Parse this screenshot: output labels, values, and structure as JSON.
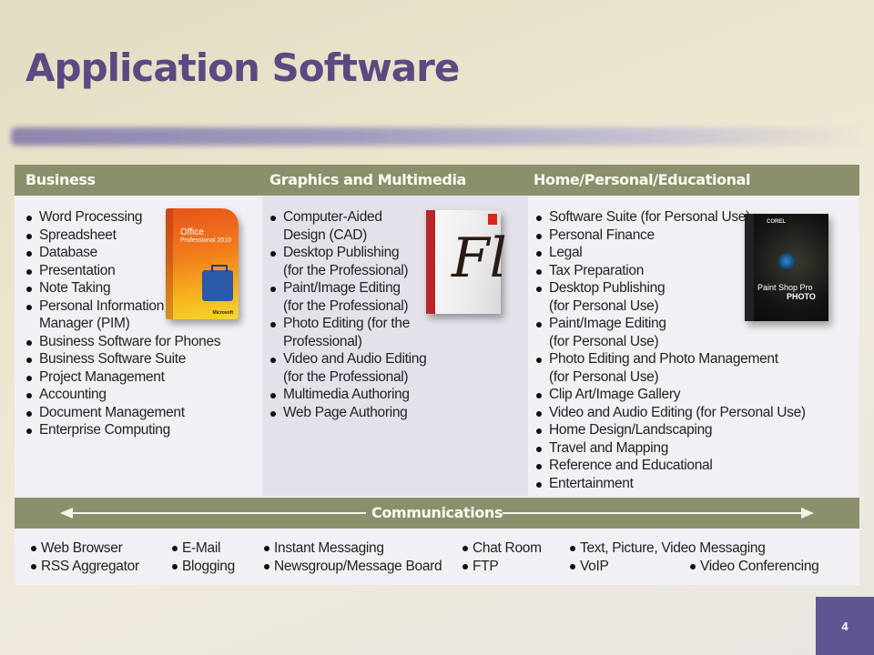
{
  "slide": {
    "title": "Application Software",
    "page_number": "4"
  },
  "columns": [
    {
      "header": "Business",
      "items": [
        "Word Processing",
        "Spreadsheet",
        "Database",
        "Presentation",
        "Note Taking",
        "Personal Information\nManager (PIM)",
        "Business Software for Phones",
        "Business Software Suite",
        "Project Management",
        "Accounting",
        "Document Management",
        "Enterprise Computing"
      ],
      "image": {
        "icon": "office-professional-box-icon",
        "label_line1": "Office",
        "label_line2": "Professional 2010",
        "brand": "Microsoft"
      }
    },
    {
      "header": "Graphics and Multimedia",
      "items": [
        "Computer-Aided\nDesign (CAD)",
        "Desktop Publishing\n(for the Professional)",
        "Paint/Image Editing\n(for the Professional)",
        "Photo Editing (for the\nProfessional)",
        "Video and Audio Editing\n(for the Professional)",
        "Multimedia Authoring",
        "Web Page Authoring"
      ],
      "image": {
        "icon": "adobe-flash-box-icon",
        "label": "Fl"
      }
    },
    {
      "header": "Home/Personal/Educational",
      "items": [
        "Software Suite (for Personal Use)",
        "Personal Finance",
        "Legal",
        "Tax Preparation",
        "Desktop Publishing\n(for Personal Use)",
        "Paint/Image Editing\n(for Personal Use)",
        "Photo Editing and Photo Management\n(for Personal Use)",
        "Clip Art/Image Gallery",
        "Video and Audio Editing (for Personal Use)",
        "Home Design/Landscaping",
        "Travel and Mapping",
        "Reference and Educational",
        "Entertainment"
      ],
      "image": {
        "icon": "paintshop-pro-photo-box-icon",
        "brand": "COREL",
        "label_line1": "Paint Shop Pro",
        "label_line2": "PHOTO"
      }
    }
  ],
  "communications": {
    "header": "Communications",
    "items": [
      "Web Browser",
      "RSS Aggregator",
      "E-Mail",
      "Blogging",
      "Instant Messaging",
      "Newsgroup/Message Board",
      "Chat Room",
      "FTP",
      "Text, Picture, Video Messaging",
      "VoIP",
      "Video Conferencing"
    ]
  },
  "colors": {
    "title": "#5a4a82",
    "header_band": "#8c8f6c",
    "page_badge": "#5f5590"
  }
}
